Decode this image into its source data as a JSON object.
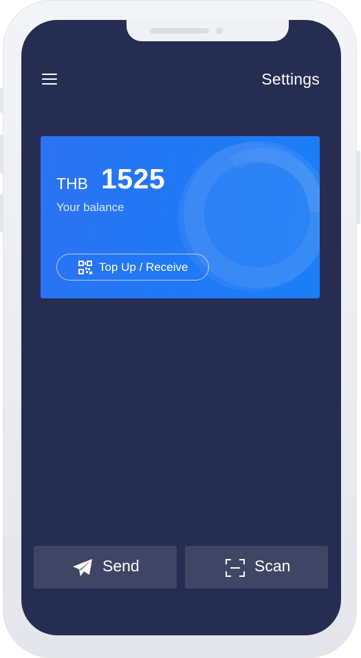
{
  "header": {
    "menu_icon": "hamburger-menu-icon",
    "settings_label": "Settings"
  },
  "balance_card": {
    "currency": "THB",
    "amount": "1525",
    "label": "Your balance",
    "topup_label": "Top Up / Receive",
    "topup_icon": "qr-code-icon"
  },
  "actions": {
    "send_label": "Send",
    "send_icon": "paper-plane-icon",
    "scan_label": "Scan",
    "scan_icon": "scan-frame-icon"
  },
  "colors": {
    "screen_background": "#252d52",
    "card_gradient_start": "#2c73f3",
    "card_gradient_end": "#1c7ef6",
    "action_button_background": "#3f4665",
    "text": "#ffffff"
  }
}
